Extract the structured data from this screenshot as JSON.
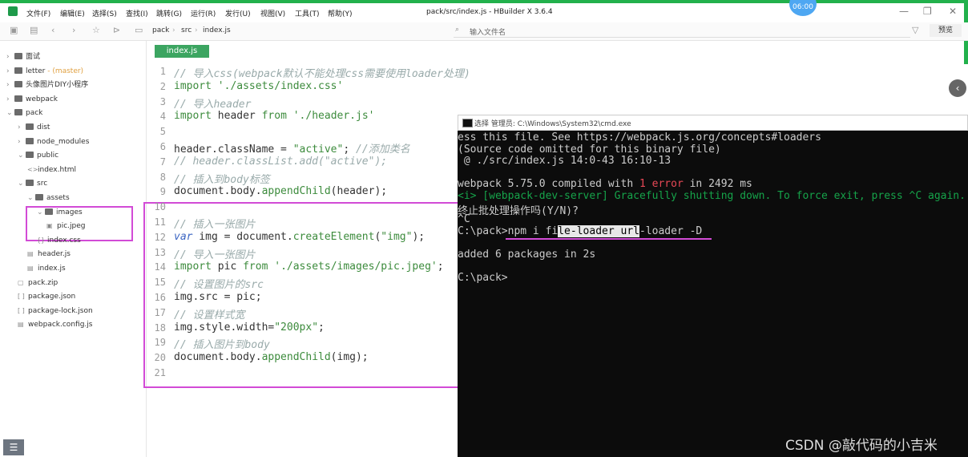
{
  "menu": [
    "文件(F)",
    "编辑(E)",
    "选择(S)",
    "查找(I)",
    "跳转(G)",
    "运行(R)",
    "发行(U)",
    "视图(V)",
    "工具(T)",
    "帮助(Y)"
  ],
  "window_title": "pack/src/index.js - HBuilder X 3.6.4",
  "clock": "06:00",
  "breadcrumb": [
    "pack",
    "src",
    "index.js"
  ],
  "file_search_placeholder": "输入文件名",
  "preview_label": "预览",
  "tree": [
    {
      "label": "面试",
      "level": 0,
      "type": "folder",
      "arrow": "›"
    },
    {
      "label": "letter",
      "suffix": " - (master)",
      "level": 0,
      "type": "folder",
      "arrow": "›"
    },
    {
      "label": "头像图片DIY小程序",
      "level": 0,
      "type": "folder",
      "arrow": "›"
    },
    {
      "label": "webpack",
      "level": 0,
      "type": "folder",
      "arrow": "›"
    },
    {
      "label": "pack",
      "level": 0,
      "type": "folder",
      "arrow": "⌄"
    },
    {
      "label": "dist",
      "level": 1,
      "type": "folder",
      "arrow": "›"
    },
    {
      "label": "node_modules",
      "level": 1,
      "type": "folder",
      "arrow": "›"
    },
    {
      "label": "public",
      "level": 1,
      "type": "folder",
      "arrow": "⌄"
    },
    {
      "label": "index.html",
      "level": 2,
      "type": "file",
      "icon": "<>"
    },
    {
      "label": "src",
      "level": 1,
      "type": "folder",
      "arrow": "⌄"
    },
    {
      "label": "assets",
      "level": 2,
      "type": "folder",
      "arrow": "⌄"
    },
    {
      "label": "images",
      "level": 3,
      "type": "folder",
      "arrow": "⌄"
    },
    {
      "label": "pic.jpeg",
      "level": 4,
      "type": "file",
      "icon": "▣"
    },
    {
      "label": "index.css",
      "level": 3,
      "type": "file",
      "icon": "{}"
    },
    {
      "label": "header.js",
      "level": 2,
      "type": "file",
      "icon": "▤"
    },
    {
      "label": "index.js",
      "level": 2,
      "type": "file",
      "icon": "▤"
    },
    {
      "label": "pack.zip",
      "level": 1,
      "type": "file",
      "icon": "▢"
    },
    {
      "label": "package.json",
      "level": 1,
      "type": "file",
      "icon": "[ ]"
    },
    {
      "label": "package-lock.json",
      "level": 1,
      "type": "file",
      "icon": "[ ]"
    },
    {
      "label": "webpack.config.js",
      "level": 1,
      "type": "file",
      "icon": "▤"
    }
  ],
  "editor_tab": "index.js",
  "code_lines": [
    "// 导入css(webpack默认不能处理css需要使用loader处理)",
    "import './assets/index.css'",
    "// 导入header",
    "import header from './header.js'",
    "",
    "header.className = \"active\"; //添加类名",
    "// header.classList.add(\"active\");",
    "// 插入到body标签",
    "document.body.appendChild(header);",
    "",
    "// 插入一张图片",
    "var img = document.createElement(\"img\");",
    "// 导入一张图片",
    "import pic from './assets/images/pic.jpeg';",
    "// 设置图片的src",
    "img.src = pic;",
    "// 设置样式宽",
    "img.style.width=\"200px\";",
    "// 插入图片到body",
    "document.body.appendChild(img);",
    ""
  ],
  "cmd": {
    "title": "选择 管理员: C:\\Windows\\System32\\cmd.exe",
    "lines": [
      "ess this file. See https://webpack.js.org/concepts#loaders",
      "(Source code omitted for this binary file)",
      " @ ./src/index.js 14:0-43 16:10-13",
      "",
      "webpack 5.75.0 compiled with 1 error in 2492 ms",
      "<i> [webpack-dev-server] Gracefully shutting down. To force exit, press ^C again. Ple",
      "终止批处理操作吗(Y/N)?",
      "^C",
      "C:\\pack>npm i file-loader url-loader -D",
      "",
      "added 6 packages in 2s",
      "",
      "C:\\pack>"
    ]
  },
  "watermark": "CSDN @敲代码的小吉米",
  "colors": {
    "accent": "#22b14c",
    "tab": "#3ca561",
    "highlight": "#d24bd6",
    "terminal_bg": "#0c0c0c"
  }
}
